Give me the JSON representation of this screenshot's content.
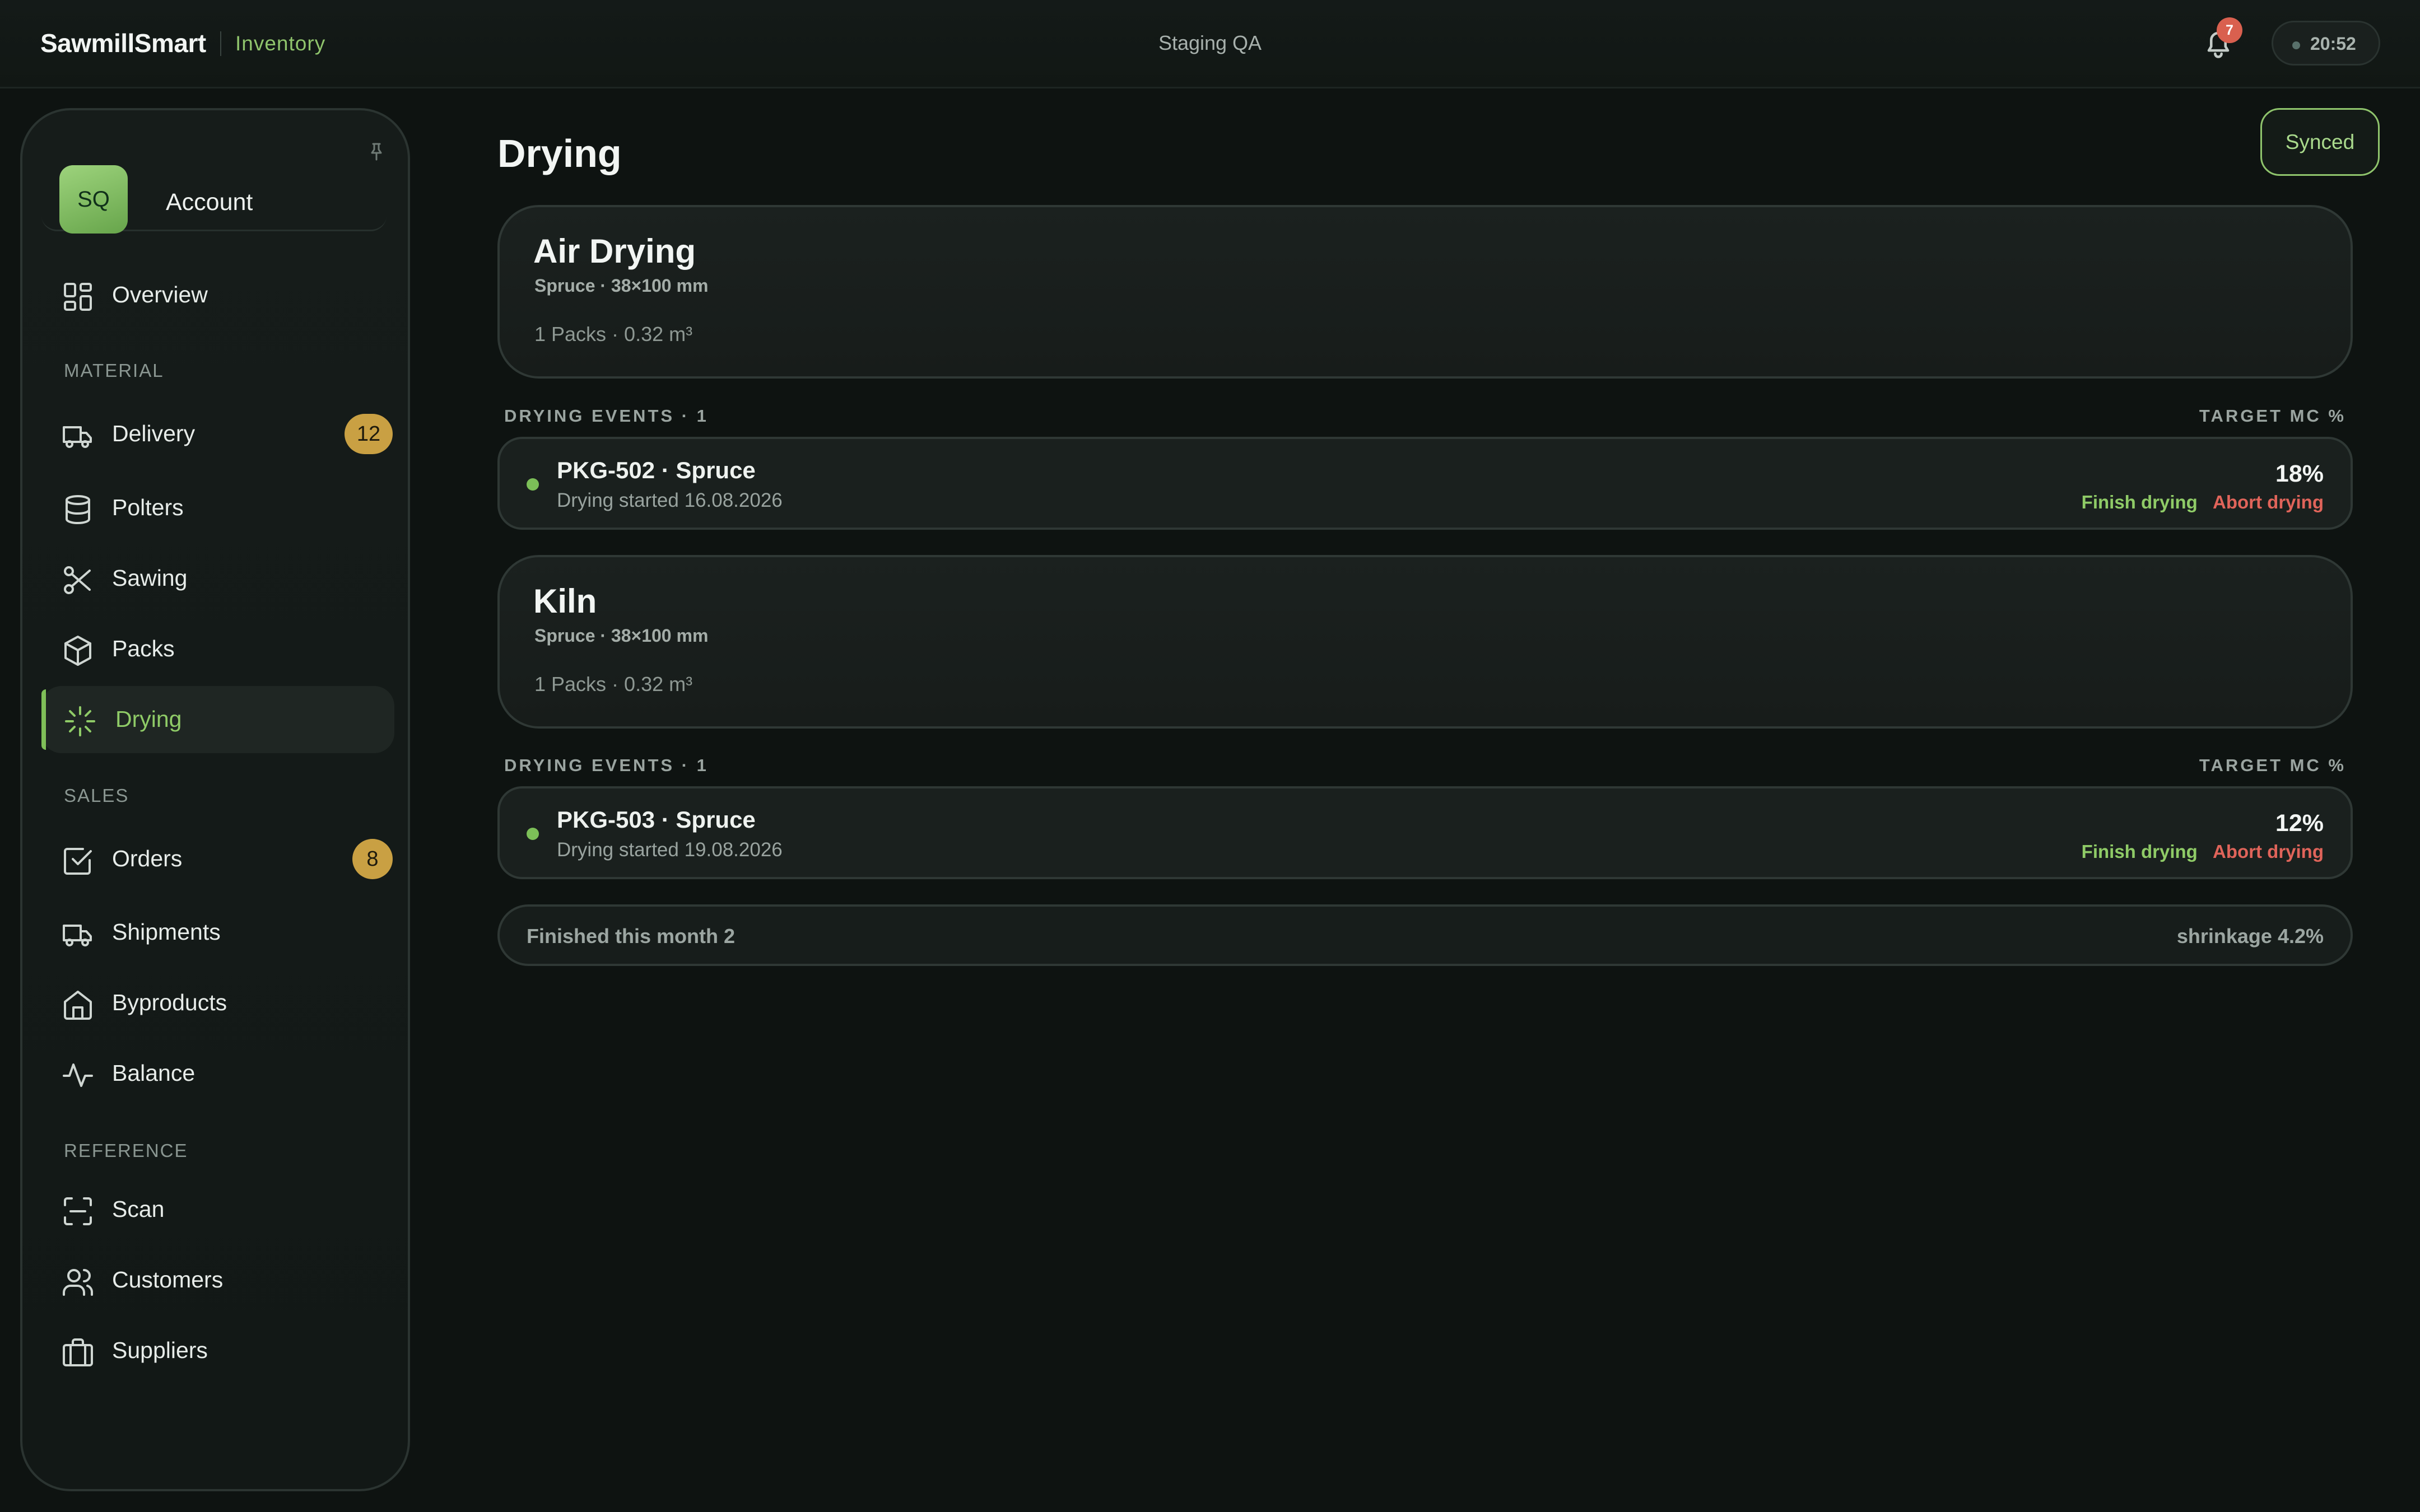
{
  "header": {
    "brand": "SawmillSmart",
    "section": "Inventory",
    "environment": "Staging QA",
    "notification_count": "7",
    "clock": "20:52"
  },
  "sidebar": {
    "account": {
      "initials": "SQ",
      "label": "Account"
    },
    "overview": "Overview",
    "sections": {
      "material": "MATERIAL",
      "sales": "SALES",
      "reference": "REFERENCE"
    },
    "items": {
      "delivery": {
        "label": "Delivery",
        "badge": "12"
      },
      "polters": {
        "label": "Polters"
      },
      "sawing": {
        "label": "Sawing"
      },
      "packs": {
        "label": "Packs"
      },
      "drying": {
        "label": "Drying"
      },
      "orders": {
        "label": "Orders",
        "badge": "8"
      },
      "shipments": {
        "label": "Shipments"
      },
      "byproducts": {
        "label": "Byproducts"
      },
      "balance": {
        "label": "Balance"
      },
      "scan": {
        "label": "Scan"
      },
      "customers": {
        "label": "Customers"
      },
      "suppliers": {
        "label": "Suppliers"
      }
    },
    "active": "drying"
  },
  "main": {
    "title": "Drying",
    "sync_status": "Synced",
    "events_header": "DRYING EVENTS · 1",
    "target_header": "TARGET MC %",
    "finish_label": "Finish drying",
    "abort_label": "Abort drying",
    "chambers": [
      {
        "name": "Air Drying",
        "spec": "Spruce · 38×100 mm",
        "meta": "1 Packs · 0.32 m³",
        "events": [
          {
            "title": "PKG-502 · Spruce",
            "subtitle": "Drying started 16.08.2026",
            "target_mc": "18%"
          }
        ]
      },
      {
        "name": "Kiln",
        "spec": "Spruce · 38×100 mm",
        "meta": "1 Packs · 0.32 m³",
        "events": [
          {
            "title": "PKG-503 · Spruce",
            "subtitle": "Drying started 19.08.2026",
            "target_mc": "12%"
          }
        ]
      }
    ],
    "summary": {
      "finished": "Finished this month 2",
      "shrinkage": "shrinkage 4.2%"
    }
  },
  "colors": {
    "accent": "#8fc46c",
    "danger": "#e0645a",
    "badge": "#c9a043",
    "background": "#0e1311"
  }
}
